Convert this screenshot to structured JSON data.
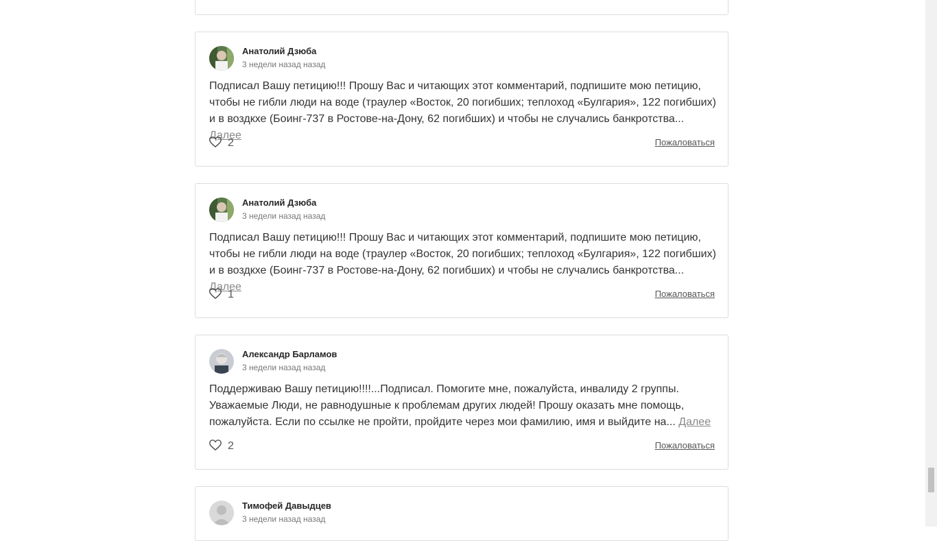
{
  "comments": [
    {
      "author": "Анатолий Дзюба",
      "time": "3 недели назад назад",
      "text": "Подписал Вашу петицию!!! Прошу Вас и читающих этот комментарий, подпишите мою петицию, чтобы не гибли люди на воде (траулер «Восток, 20 погибших; теплоход «Булгария», 122 погибших) и в воздкхе (Боинг-737 в Ростове-на-Дону, 62 погибших) и чтобы не случались банкротства...",
      "more": "Далее",
      "likes": "2",
      "report": "Пожаловаться"
    },
    {
      "author": "Анатолий Дзюба",
      "time": "3 недели назад назад",
      "text": "Подписал Вашу петицию!!! Прошу Вас и читающих этот комментарий, подпишите мою петицию, чтобы не гибли люди на воде (траулер «Восток, 20 погибших; теплоход «Булгария», 122 погибших) и в воздкхе (Боинг-737 в Ростове-на-Дону, 62 погибших) и чтобы не случались банкротства...",
      "more": "Далее",
      "likes": "1",
      "report": "Пожаловаться"
    },
    {
      "author": "Александр Барламов",
      "time": "3 недели назад назад",
      "text": "Поддерживаю Вашу петицию!!!!...Подписал. Помогите мне, пожалуйста, инвалиду 2 группы. Уважаемые Люди, не равнодушные к проблемам других людей! Прошу оказать мне помощь, пожалуйста. Если по ссылке не пройти, пройдите через мои фамилию, имя и выйдите на...",
      "more": "Далее",
      "likes": "2",
      "report": "Пожаловаться"
    },
    {
      "author": "Тимофей Давыдцев",
      "time": "3 недели назад назад"
    }
  ],
  "colors": {
    "border": "#dcdcdc",
    "text": "#333333",
    "muted": "#777777"
  },
  "icons": {
    "like": "heart-icon",
    "avatar_placeholder": "user-placeholder-icon"
  }
}
